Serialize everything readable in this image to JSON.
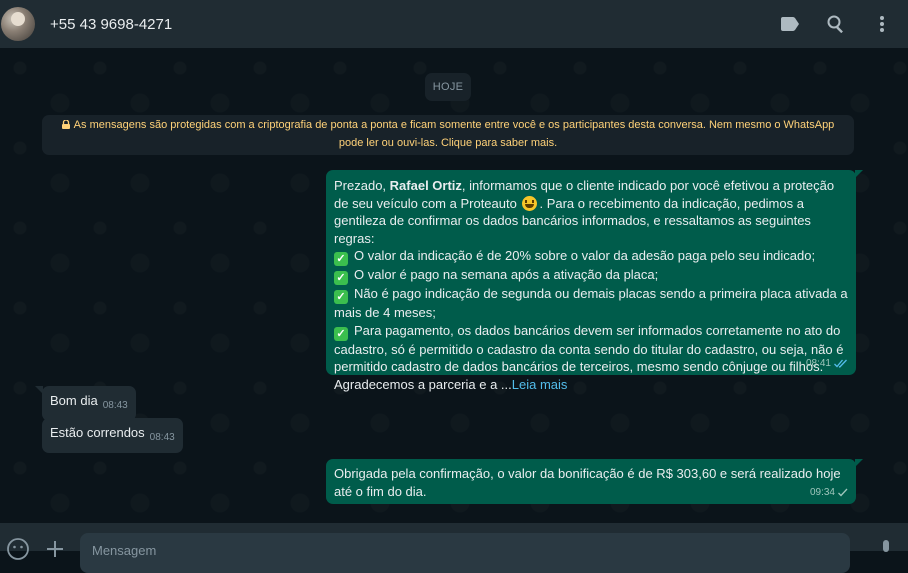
{
  "header": {
    "contact": "+55 43 9698-4271",
    "icons": [
      "labels-icon",
      "search-icon",
      "menu-icon"
    ]
  },
  "chat": {
    "date_chip": "HOJE",
    "encryption_notice": {
      "line1": "As mensagens são protegidas com a criptografia de ponta a ponta e ficam somente entre você e os participantes desta conversa. Nem mesmo o WhatsApp",
      "line2": "pode ler ou ouvi-las. Clique para saber mais."
    },
    "messages": [
      {
        "direction": "outgoing",
        "intro_pre": "Prezado, ",
        "intro_name": "Rafael Ortiz",
        "intro_post": ", informamos que o cliente indicado por você efetivou a proteção de seu veículo com a Proteauto",
        "intro_rest": ". Para o recebimento da indicação, pedimos a gentileza de confirmar os dados bancários informados, e ressaltamos as seguintes regras:",
        "rules": [
          "O valor da indicação é de 20% sobre o valor da adesão paga pelo seu indicado;",
          "O valor é pago na semana após a ativação da placa;",
          "Não é pago indicação de segunda ou demais placas sendo a primeira placa ativada a mais de 4 meses;",
          "Para pagamento, os dados bancários devem ser informados corretamente no ato do cadastro, só é permitido o cadastro da conta sendo do titular do cadastro, ou seja, não é permitido cadastro de dados bancários de terceiros, mesmo sendo cônjuge ou filhos."
        ],
        "closing": "Agradecemos a parceria e a ...",
        "read_more": "Leia mais",
        "time": "08:41",
        "status": "read"
      },
      {
        "direction": "incoming",
        "text": "Bom dia",
        "time": "08:43"
      },
      {
        "direction": "incoming",
        "text": "Estão correndos",
        "time": "08:43"
      },
      {
        "direction": "outgoing",
        "text": "Obrigada pela confirmação, o valor da bonificação é de R$ 303,60 e será realizado hoje até o fim do dia.",
        "time": "09:34",
        "status": "sent"
      }
    ]
  },
  "composer": {
    "placeholder": "Mensagem"
  },
  "colors": {
    "outgoing_bubble": "#005c4b",
    "incoming_bubble": "#202c33",
    "link": "#53bdeb",
    "notice_text": "#ffd279"
  }
}
